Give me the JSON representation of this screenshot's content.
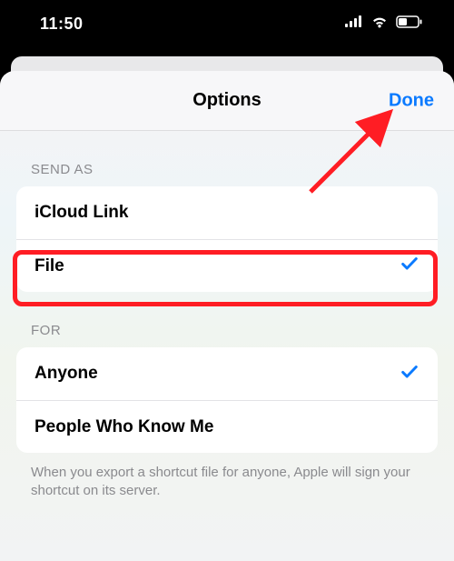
{
  "status": {
    "time": "11:50"
  },
  "nav": {
    "title": "Options",
    "done": "Done"
  },
  "sections": {
    "send_as": {
      "header": "SEND AS",
      "items": [
        "iCloud Link",
        "File"
      ],
      "selected_index": 1
    },
    "for": {
      "header": "FOR",
      "items": [
        "Anyone",
        "People Who Know Me"
      ],
      "selected_index": 0
    }
  },
  "footer_note": "When you export a shortcut file for anyone, Apple will sign your shortcut on its server.",
  "colors": {
    "accent": "#0a7aff",
    "annotation": "#ff1d24"
  },
  "annotation": {
    "highlight_row": "File",
    "arrow_target": "Done"
  }
}
